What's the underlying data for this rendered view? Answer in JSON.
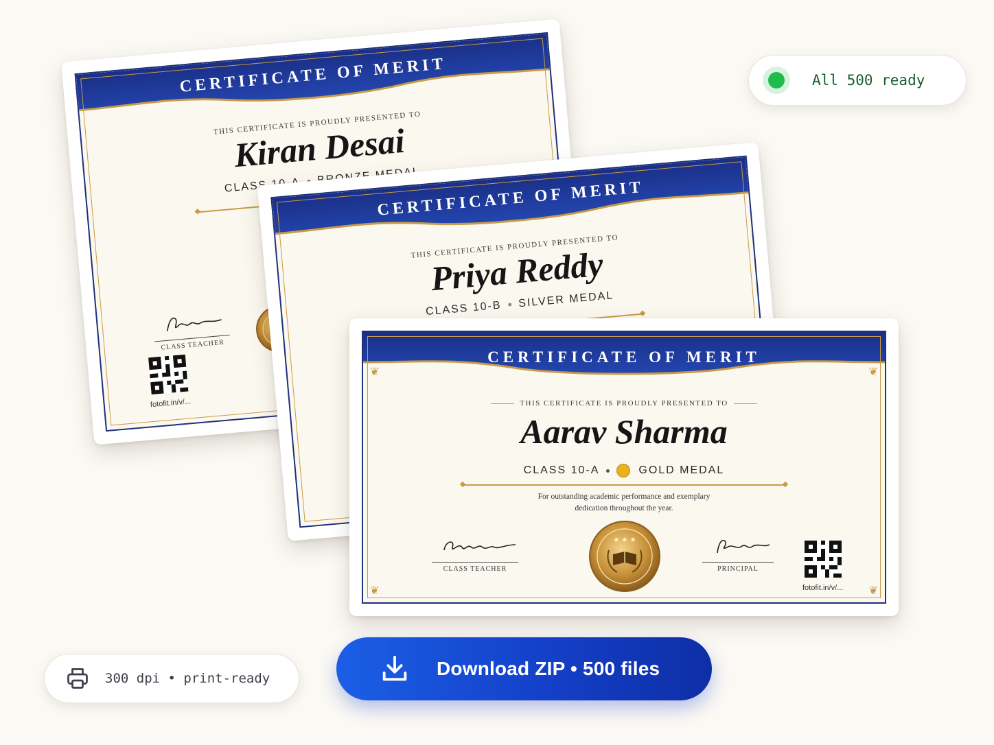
{
  "status": {
    "text": "All 500 ready",
    "color": "#1fbb4c"
  },
  "print_info": {
    "icon": "printer-icon",
    "text": "300 dpi • print-ready"
  },
  "download": {
    "icon": "download-icon",
    "label": "Download ZIP • 500 files"
  },
  "certificates": [
    {
      "title": "CERTIFICATE OF MERIT",
      "presented": "THIS CERTIFICATE IS PROUDLY PRESENTED TO",
      "name": "Kiran Desai",
      "class": "CLASS 10-A",
      "medal": "BRONZE MEDAL",
      "signatory": "CLASS TEACHER",
      "qr_url": "fotofit.in/v/..."
    },
    {
      "title": "CERTIFICATE OF MERIT",
      "presented": "THIS CERTIFICATE IS PROUDLY PRESENTED TO",
      "name": "Priya Reddy",
      "class": "CLASS 10-B",
      "medal": "SILVER MEDAL"
    },
    {
      "title": "CERTIFICATE OF MERIT",
      "presented": "THIS CERTIFICATE IS PROUDLY PRESENTED TO",
      "name": "Aarav Sharma",
      "class": "CLASS 10-A",
      "medal": "GOLD MEDAL",
      "medal_color": "#e8b21c",
      "description_line1": "For outstanding academic performance and exemplary",
      "description_line2": "dedication throughout the year.",
      "signatory_left": "CLASS TEACHER",
      "signatory_right": "PRINCIPAL",
      "qr_url": "fotofit.in/v/..."
    }
  ],
  "colors": {
    "navy": "#1e2f7a",
    "gold": "#c89b45",
    "accent": "#1440c9"
  }
}
